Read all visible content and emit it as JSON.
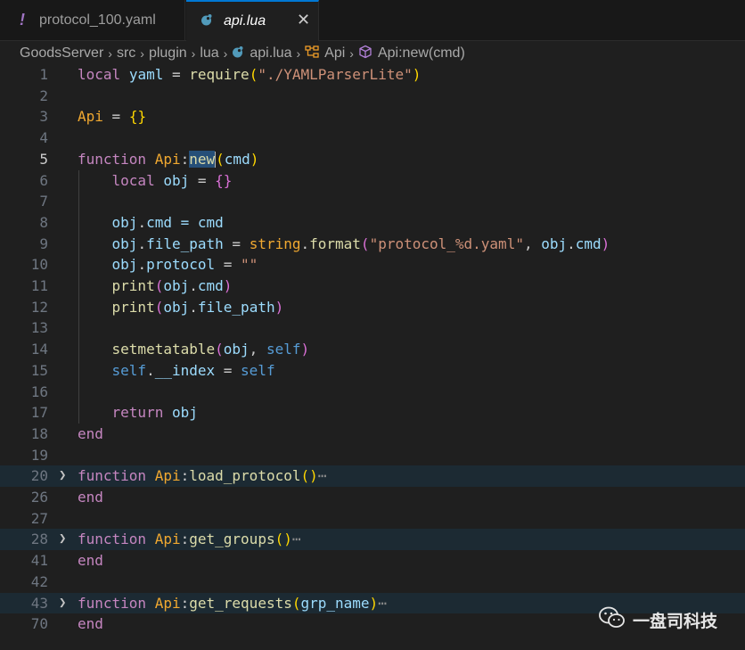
{
  "tabs": [
    {
      "label": "protocol_100.yaml",
      "icon": "exclamation-icon",
      "icon_glyph": "!"
    },
    {
      "label": "api.lua",
      "icon": "lua-icon",
      "close_glyph": "✕"
    }
  ],
  "breadcrumb": {
    "items": [
      "GoodsServer",
      "src",
      "plugin",
      "lua",
      "api.lua",
      "Api",
      "Api:new(cmd)"
    ],
    "separator": "›"
  },
  "editor": {
    "line_numbers": [
      "1",
      "2",
      "3",
      "4",
      "5",
      "6",
      "7",
      "8",
      "9",
      "10",
      "11",
      "12",
      "13",
      "14",
      "15",
      "16",
      "17",
      "18",
      "19",
      "20",
      "26",
      "27",
      "28",
      "41",
      "42",
      "43",
      "70"
    ],
    "ellipsis": "⋯",
    "code": {
      "l1_local": "local",
      "l1_yaml": "yaml",
      "l1_eq": " = ",
      "l1_require": "require",
      "l1_str": "\"./YAMLParserLite\"",
      "l3_api": "Api",
      "l3_eq": " = ",
      "l3_braces": "{}",
      "l5_function": "function",
      "l5_api": "Api",
      "l5_new": "new",
      "l5_cmd": "cmd",
      "l6_local": "local",
      "l6_obj": "obj",
      "l6_eq": " = ",
      "l6_braces": "{}",
      "l8_obj": "obj",
      "l8_cmd": "cmd",
      "l8_rest": " = cmd",
      "l9_obj": "obj",
      "l9_fp": "file_path",
      "l9_eq": " = ",
      "l9_string": "string",
      "l9_format": "format",
      "l9_str": "\"protocol_%d.yaml\"",
      "l9_obj2": "obj",
      "l9_cmd": "cmd",
      "l10_obj": "obj",
      "l10_protocol": "protocol",
      "l10_eq": " = ",
      "l10_str": "\"\"",
      "l11_print": "print",
      "l11_obj": "obj",
      "l11_cmd": "cmd",
      "l12_print": "print",
      "l12_obj": "obj",
      "l12_fp": "file_path",
      "l14_setmt": "setmetatable",
      "l14_obj": "obj",
      "l14_self": "self",
      "l15_self": "self",
      "l15_index": "__index",
      "l15_eq": " = ",
      "l15_self2": "self",
      "l17_return": "return",
      "l17_obj": "obj",
      "l18_end": "end",
      "l20_function": "function",
      "l20_api": "Api",
      "l20_name": "load_protocol",
      "l26_end": "end",
      "l28_function": "function",
      "l28_api": "Api",
      "l28_name": "get_groups",
      "l41_end": "end",
      "l43_function": "function",
      "l43_api": "Api",
      "l43_name": "get_requests",
      "l43_param": "grp_name",
      "l70_end": "end"
    }
  },
  "watermark": {
    "text": "一盘司科技",
    "icon": "wechat-icon"
  },
  "colors": {
    "accent": "#0078d4",
    "background": "#1f1f1f",
    "keyword": "#c586c0",
    "class": "#f0a830",
    "function": "#dcdcaa",
    "string": "#ce9178"
  }
}
